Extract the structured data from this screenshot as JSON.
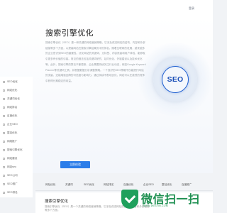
{
  "header": {
    "login_label": "登录"
  },
  "hero": {
    "title": "搜索引擎优化",
    "body": "搜索引擎优化（SEO）是一种关键的网络营销策略，它涉及改进网站的结构、内容和外部链接等多个方面，以提高网站在搜索引擎结果页中的排名。随着互联网的发展，越来越多的企业意识到SEO的重要性。优化网站的关键词、元标签、内容质量和用户体验，能够吸引更多有价值的访客。常见的做法包括关键词研究、站内优化、外链建设以及技术优化等。此外，搜索引擎的算法不断更新，企业需要持续关注行业动态，例如Google Keyword Planner等关键词工具，并根据数据分析调整策略。一个良好的SEO策略不仅能提升网站的流量，还能增强品牌的可信度与影响力。通过持续不断地优化，网站可以在激烈的竞争中获得长期稳定的收益。",
    "cta_label": "立即体验",
    "seo_badge": "SEO"
  },
  "sidenav": {
    "items": [
      "SEO优化",
      "网站优化",
      "关键词优化",
      "网站排名",
      "百度优化",
      "企业SEO",
      "整站优化",
      "网络推广",
      "搜索引擎优化",
      "网站建设",
      "网站seo",
      "SEO公司",
      "SEO推广",
      "SEO排名"
    ]
  },
  "tabs": [
    "网站优化",
    "关键词",
    "SEO优化",
    "网站排名",
    "百度优化",
    "企业SEO",
    "整站优化",
    "百度推广"
  ],
  "card": {
    "title": "搜索引擎优化",
    "body": "搜索引擎优化（SEO）是一个关键的网络营销策略，它涉及改进网站的结构、内容和外部链接等多个方面。"
  },
  "watermark": {
    "main": "微信扫一扫",
    "sub": "WWW.WEIXIN.COM"
  }
}
